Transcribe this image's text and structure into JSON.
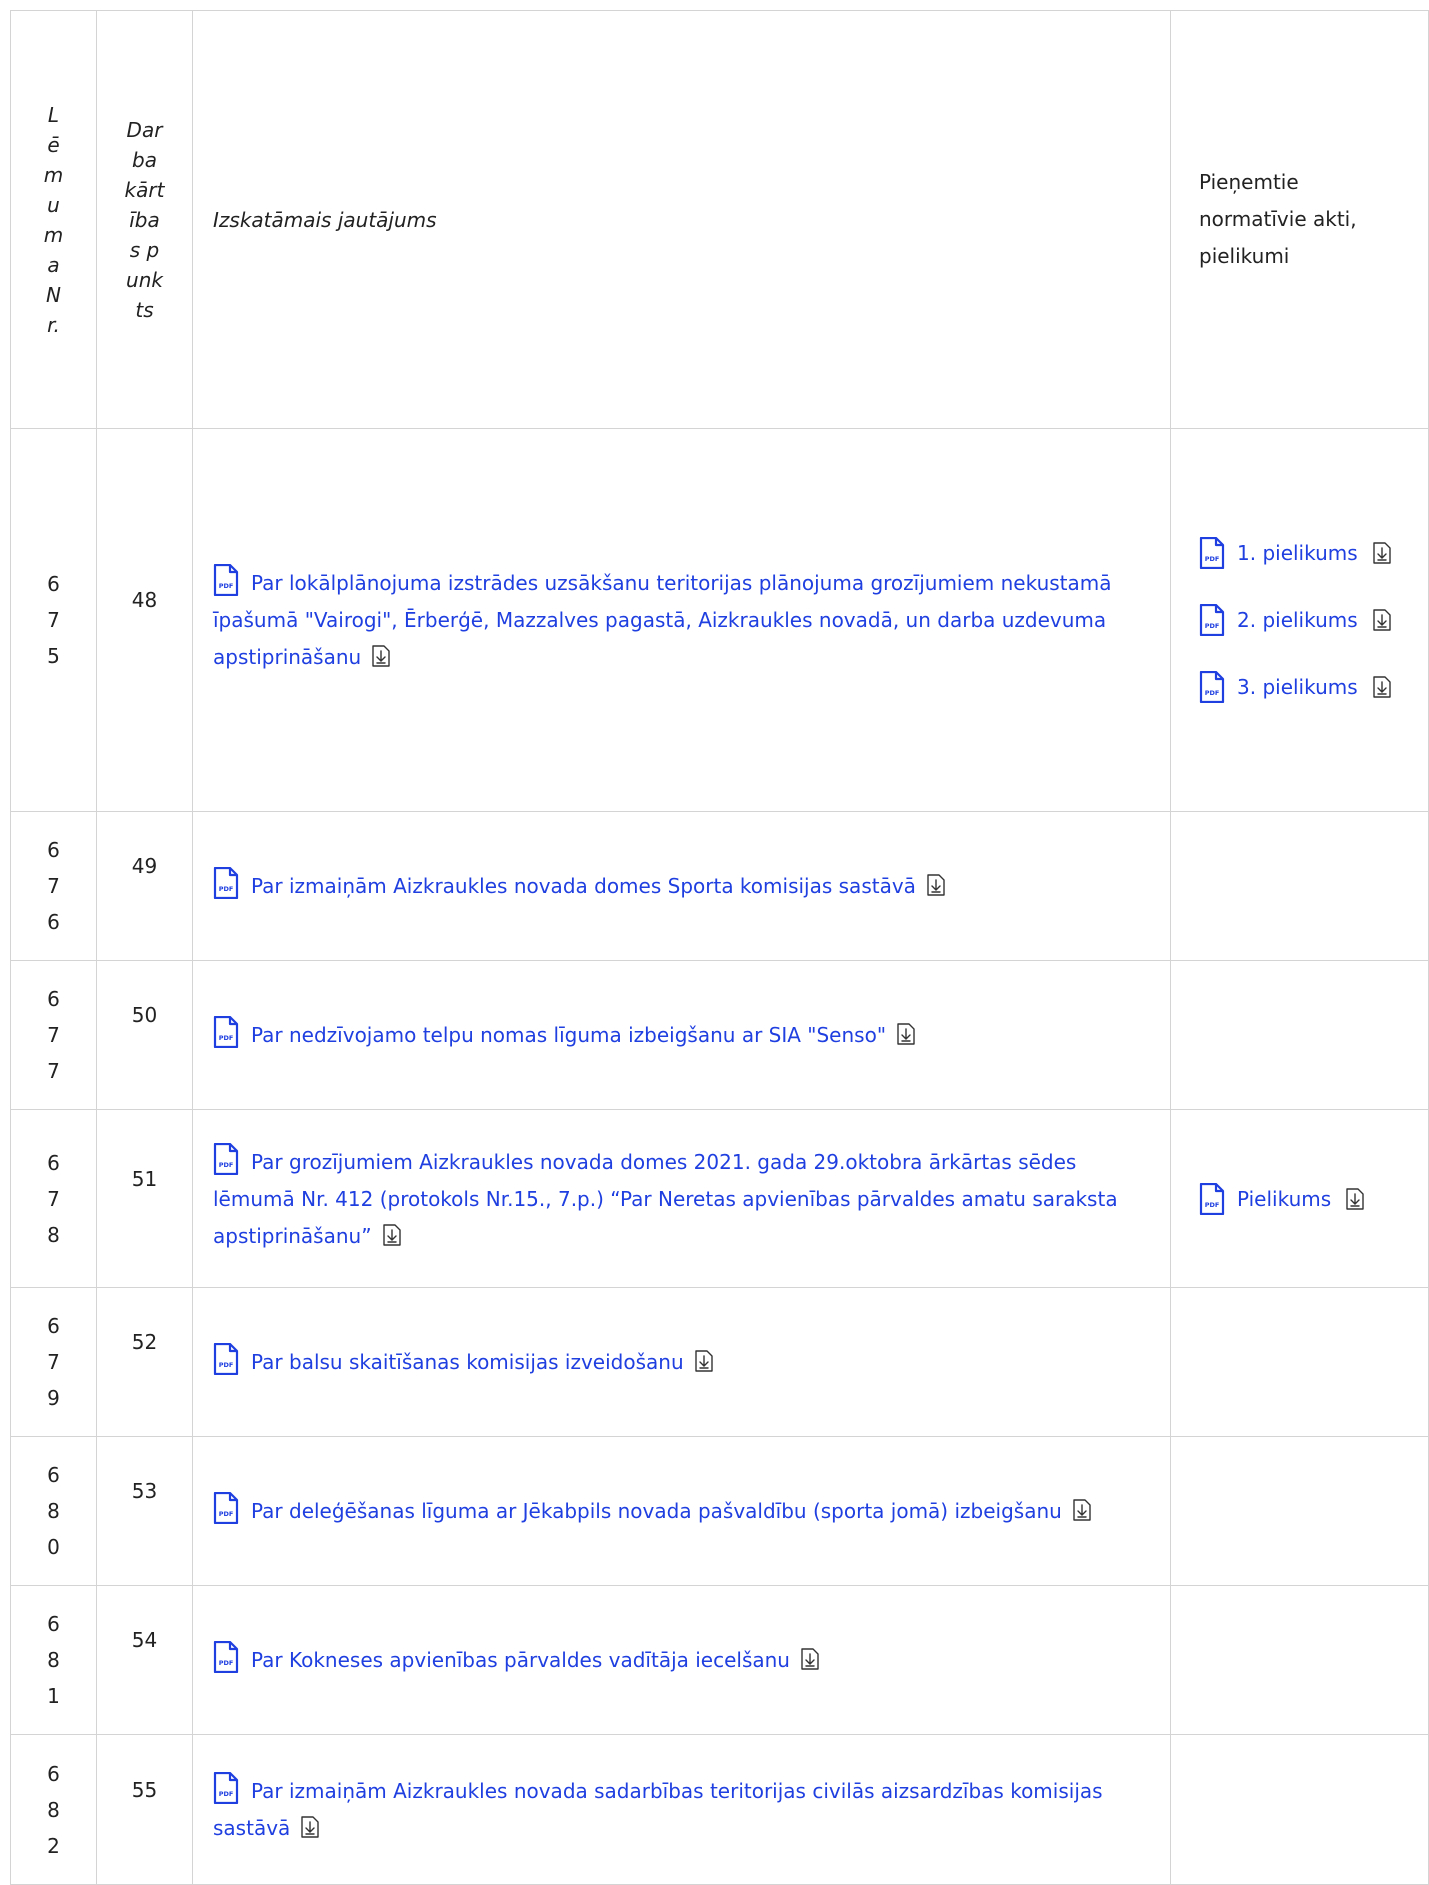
{
  "headers": {
    "col1": "Lēmuma Nr.",
    "col2": "Darba kārtības punkts",
    "col3": "Izskatāmais jautājums",
    "col4": "Pieņemtie normatīvie akti, pielikumi"
  },
  "rows": [
    {
      "nr": "675",
      "punkts": "48",
      "jautajums": "Par lokālplānojuma izstrādes uzsākšanu teritorijas plānojuma grozījumiem nekustamā īpašumā \"Vairogi\", Ērberģē, Mazzalves pagastā, Aizkraukles novadā, un darba uzdevuma apstiprināšanu",
      "pielikumi": [
        "1. pielikums",
        "2. pielikums",
        "3. pielikums"
      ]
    },
    {
      "nr": "676",
      "punkts": "49",
      "jautajums": "Par izmaiņām Aizkraukles novada domes Sporta komisijas sastāvā",
      "pielikumi": []
    },
    {
      "nr": "677",
      "punkts": "50",
      "jautajums": "Par nedzīvojamo telpu nomas līguma izbeigšanu ar SIA \"Senso\"",
      "pielikumi": []
    },
    {
      "nr": "678",
      "punkts": "51",
      "jautajums": "Par grozījumiem Aizkraukles novada domes 2021. gada 29.oktobra ārkārtas sēdes lēmumā Nr. 412 (protokols Nr.15., 7.p.) “Par Neretas apvienības pārvaldes amatu saraksta apstiprināšanu”",
      "pielikumi": [
        "Pielikums"
      ]
    },
    {
      "nr": "679",
      "punkts": "52",
      "jautajums": "Par balsu skaitīšanas komisijas izveidošanu",
      "pielikumi": []
    },
    {
      "nr": "680",
      "punkts": "53",
      "jautajums": "Par deleģēšanas līguma ar Jēkabpils novada pašvaldību (sporta jomā) izbeigšanu",
      "pielikumi": []
    },
    {
      "nr": "681",
      "punkts": "54",
      "jautajums": "Par Kokneses apvienības pārvaldes vadītāja iecelšanu",
      "pielikumi": []
    },
    {
      "nr": "682",
      "punkts": "55",
      "jautajums": "Par izmaiņām Aizkraukles novada sadarbības teritorijas civilās aizsardzības komisijas sastāvā",
      "pielikumi": []
    }
  ],
  "icons": {
    "pdf": "pdf-file-icon",
    "download": "download-icon"
  },
  "colors": {
    "link": "#1f3fe0",
    "border": "#d4d4d4"
  }
}
